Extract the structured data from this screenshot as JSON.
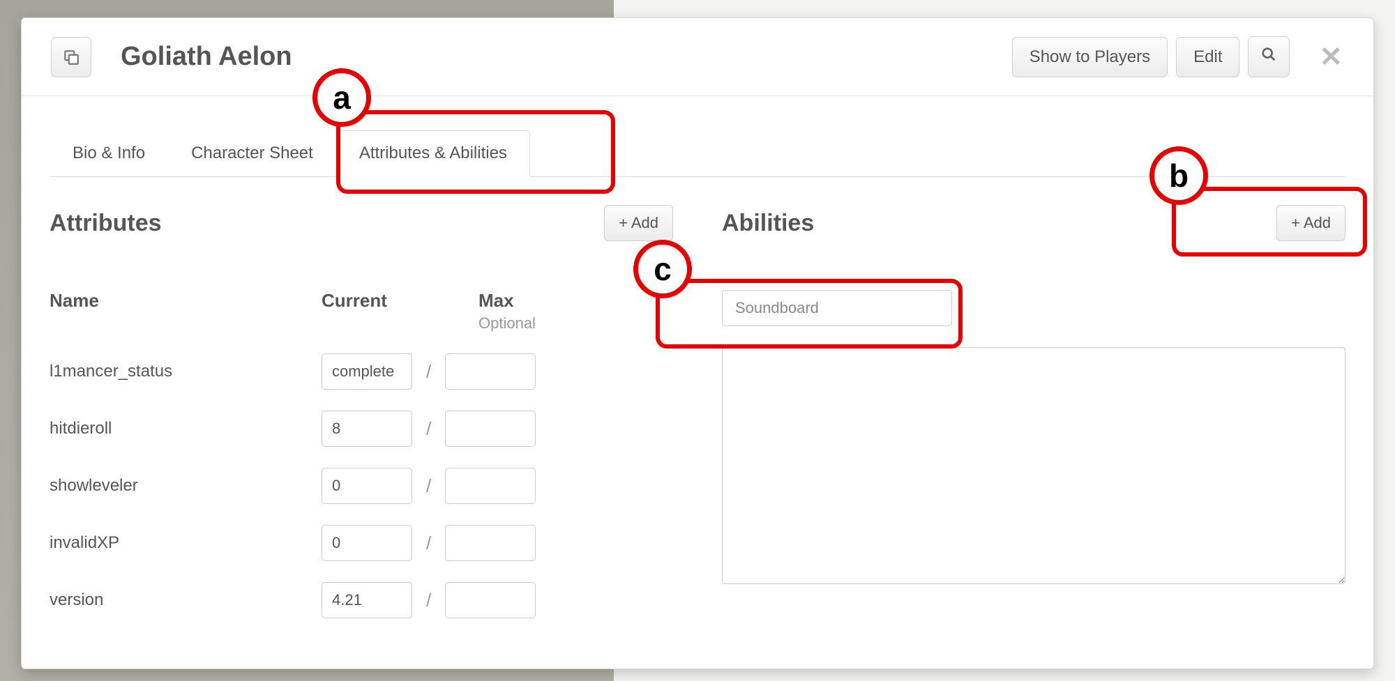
{
  "header": {
    "title": "Goliath Aelon",
    "show_to_players": "Show to Players",
    "edit": "Edit"
  },
  "tabs": {
    "bio": "Bio & Info",
    "sheet": "Character Sheet",
    "attrs": "Attributes & Abilities"
  },
  "attributes": {
    "title": "Attributes",
    "add": "+ Add",
    "head_name": "Name",
    "head_current": "Current",
    "head_max": "Max",
    "head_optional": "Optional",
    "rows": [
      {
        "name": "l1mancer_status",
        "current": "complete",
        "max": ""
      },
      {
        "name": "hitdieroll",
        "current": "8",
        "max": ""
      },
      {
        "name": "showleveler",
        "current": "0",
        "max": ""
      },
      {
        "name": "invalidXP",
        "current": "0",
        "max": ""
      },
      {
        "name": "version",
        "current": "4.21",
        "max": ""
      }
    ]
  },
  "abilities": {
    "title": "Abilities",
    "add": "+ Add",
    "name_value": "Soundboard",
    "body_value": ""
  },
  "annotations": {
    "a": "a",
    "b": "b",
    "c": "c"
  }
}
